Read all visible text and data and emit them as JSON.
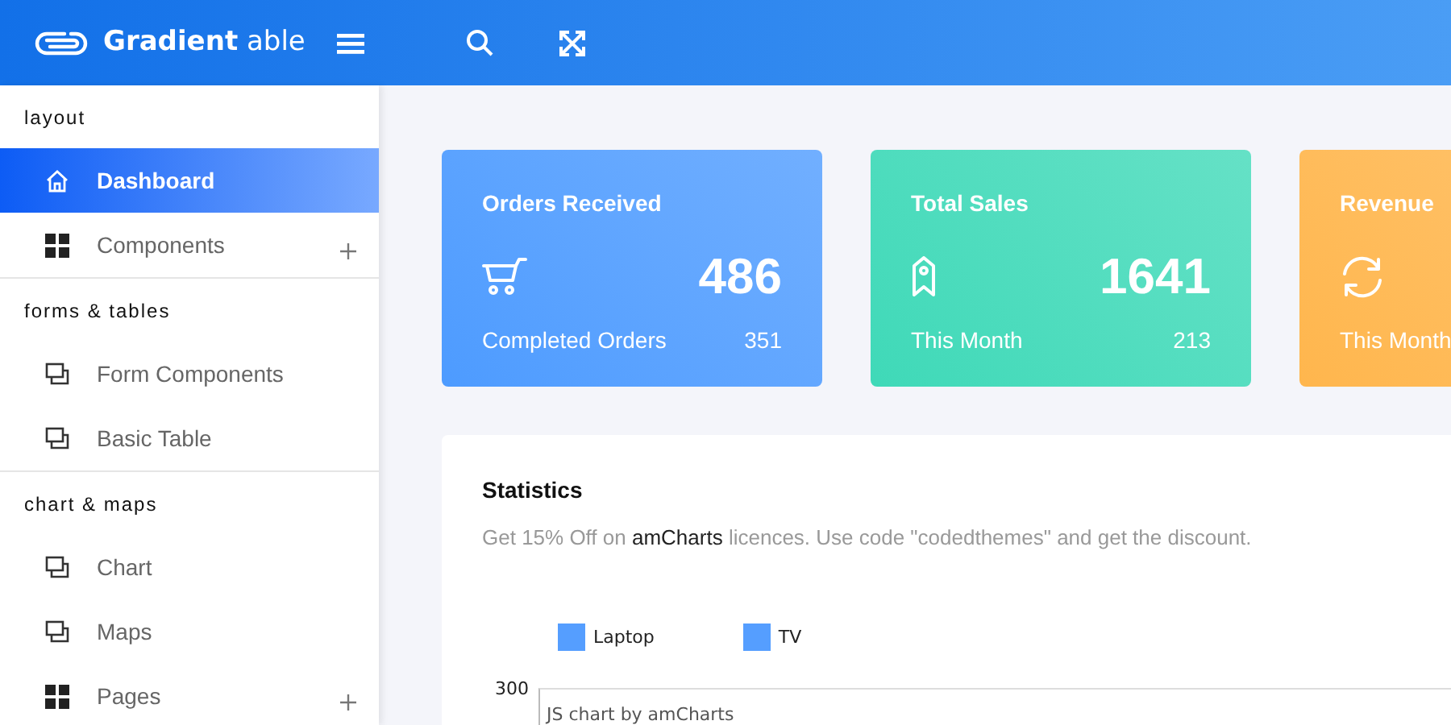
{
  "header": {
    "logo_text": "**Gradient** able"
  },
  "sidebar": {
    "sections": [
      {
        "title": "layout",
        "items": [
          {
            "label": "Dashboard",
            "kind": "home",
            "selected": true
          },
          {
            "label": "Components",
            "kind": "group",
            "selected": false
          }
        ]
      },
      {
        "title": "forms & tables",
        "items": [
          {
            "label": "Form Components",
            "kind": "page",
            "selected": false
          },
          {
            "label": "Basic Table",
            "kind": "page",
            "selected": false
          }
        ]
      },
      {
        "title": "chart & maps",
        "items": [
          {
            "label": "Chart",
            "kind": "page",
            "selected": false
          },
          {
            "label": "Maps",
            "kind": "page",
            "selected": false
          },
          {
            "label": "Pages",
            "kind": "group",
            "selected": false
          }
        ]
      }
    ]
  },
  "stat_cards": [
    {
      "title": "Orders Received",
      "kind": "cart",
      "value": "486",
      "caption": "Completed Orders",
      "count": "351",
      "color": "#4d9bff"
    },
    {
      "title": "Total Sales",
      "kind": "tag",
      "value": "1641",
      "caption": "This Month",
      "count": "213",
      "color": "#3fd9b8"
    },
    {
      "title": "Revenue",
      "kind": "refresh",
      "caption": "This Month",
      "color": "#ffb64d"
    }
  ],
  "statistics": {
    "title": "Statistics",
    "subtitle": "Get 15% Off on **amCharts** licences. Use code \"codedthemes\" and get the discount.",
    "legend": [
      {
        "label": "Laptop",
        "color": "#559eff"
      },
      {
        "label": "TV",
        "color": "#559eff"
      }
    ],
    "y_tick": "300",
    "credit": "JS chart by amCharts"
  }
}
